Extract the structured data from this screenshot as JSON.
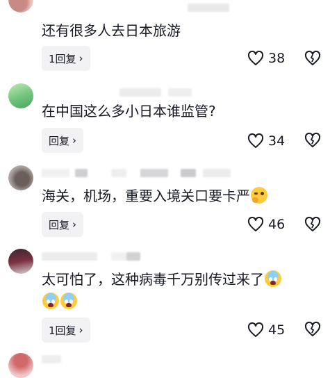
{
  "comments": [
    {
      "text": "还有很多人去日本旅游",
      "reply_label": "1回复",
      "likes": "38"
    },
    {
      "text": "在中国这么多小日本谁监管?",
      "reply_label": "回复",
      "likes": "34"
    },
    {
      "text": "海关，机场，重要入境关口要卡严",
      "reply_label": "回复",
      "likes": "46"
    },
    {
      "text": "太可怕了，这种病毒千万别传过来了",
      "reply_label": "1回复",
      "likes": "45"
    }
  ],
  "icons": {
    "like": "heart-outline-icon",
    "dislike": "dislike-heart-icon",
    "reply_chevron": "chevron-right-icon",
    "emoji_think": "thinking-face-emoji",
    "emoji_fear": "screaming-face-emoji"
  },
  "colors": {
    "text": "#161823",
    "reply_bg": "#f2f2f4",
    "placeholder_blur": "#e4e4e6"
  }
}
